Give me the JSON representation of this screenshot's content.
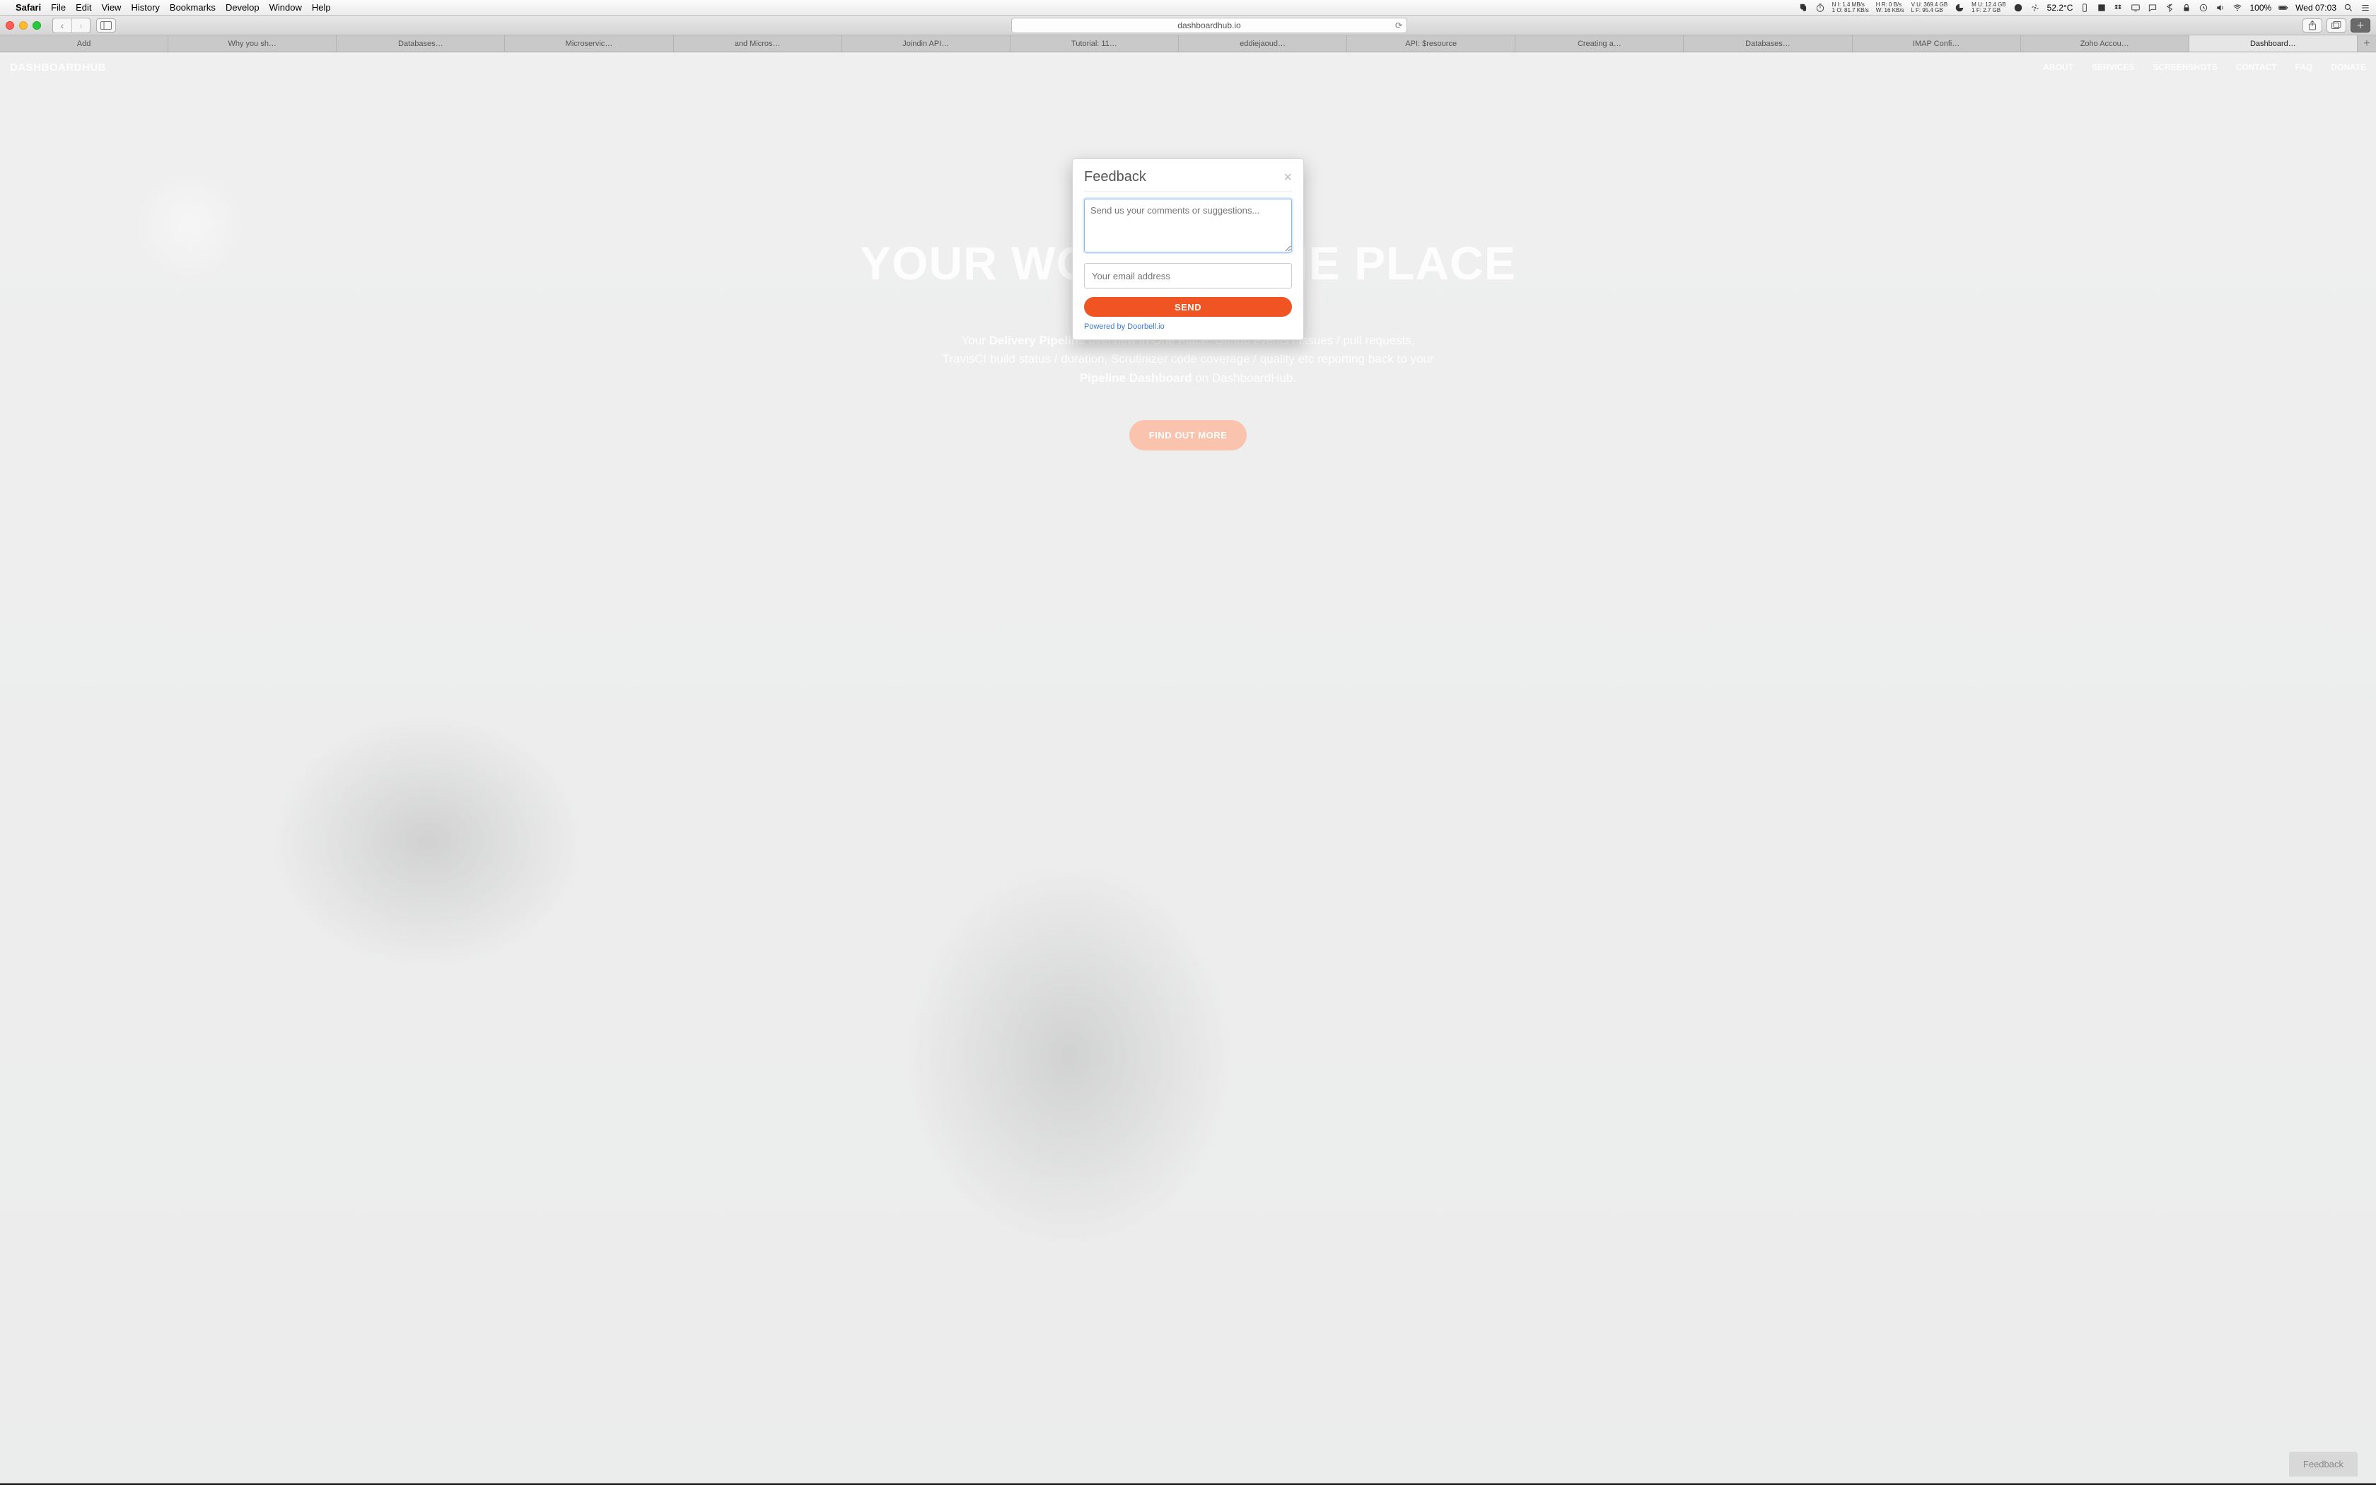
{
  "menubar": {
    "app_name": "Safari",
    "items": [
      "File",
      "Edit",
      "View",
      "History",
      "Bookmarks",
      "Develop",
      "Window",
      "Help"
    ],
    "network1_top": "N  I: 1.4 MB/s",
    "network1_bot": "1  O: 81.7 KB/s",
    "network2_top": "H  R: 0 B/s",
    "network2_bot": "W: 16 KB/s",
    "vol_top": "V  U: 369.4 GB",
    "vol_bot": "L  F: 95.4 GB",
    "mem_top": "M  U: 12.4 GB",
    "mem_bot": "1  F: 2.7 GB",
    "temp": "52.2°C",
    "battery": "100%",
    "clock": "Wed 07:03"
  },
  "toolbar": {
    "url": "dashboardhub.io"
  },
  "tabs": [
    "Add",
    "Why you sh…",
    "Databases…",
    "Microservic…",
    "and Micros…",
    "Joindin API…",
    "Tutorial: 11…",
    "eddiejaoud…",
    "API: $resource",
    "Creating a…",
    "Databases…",
    "IMAP Confi…",
    "Zoho Accou…",
    "Dashboard…"
  ],
  "active_tab_index": 13,
  "site": {
    "brand": "DASHBOARDHUB",
    "nav": [
      "ABOUT",
      "SERVICES",
      "SCREENSHOTS",
      "CONTACT",
      "FAQ",
      "DONATE"
    ],
    "headline": "YOUR WORK IN ONE PLACE",
    "sub_pre": "Your ",
    "sub_b1": "Delivery Pipeline",
    "sub_mid": " overview in One Place. Github events / issues / pull requests, TravisCI build status / duration, Scrutinizer code coverage / quality etc reporting back to your ",
    "sub_b2": "Pipeline Dashboard",
    "sub_post": " on DashboardHub.",
    "cta": "FIND OUT MORE",
    "feedback_tab": "Feedback"
  },
  "modal": {
    "title": "Feedback",
    "comments_placeholder": "Send us your comments or suggestions...",
    "email_placeholder": "Your email address",
    "send_label": "SEND",
    "powered": "Powered by Doorbell.io"
  }
}
